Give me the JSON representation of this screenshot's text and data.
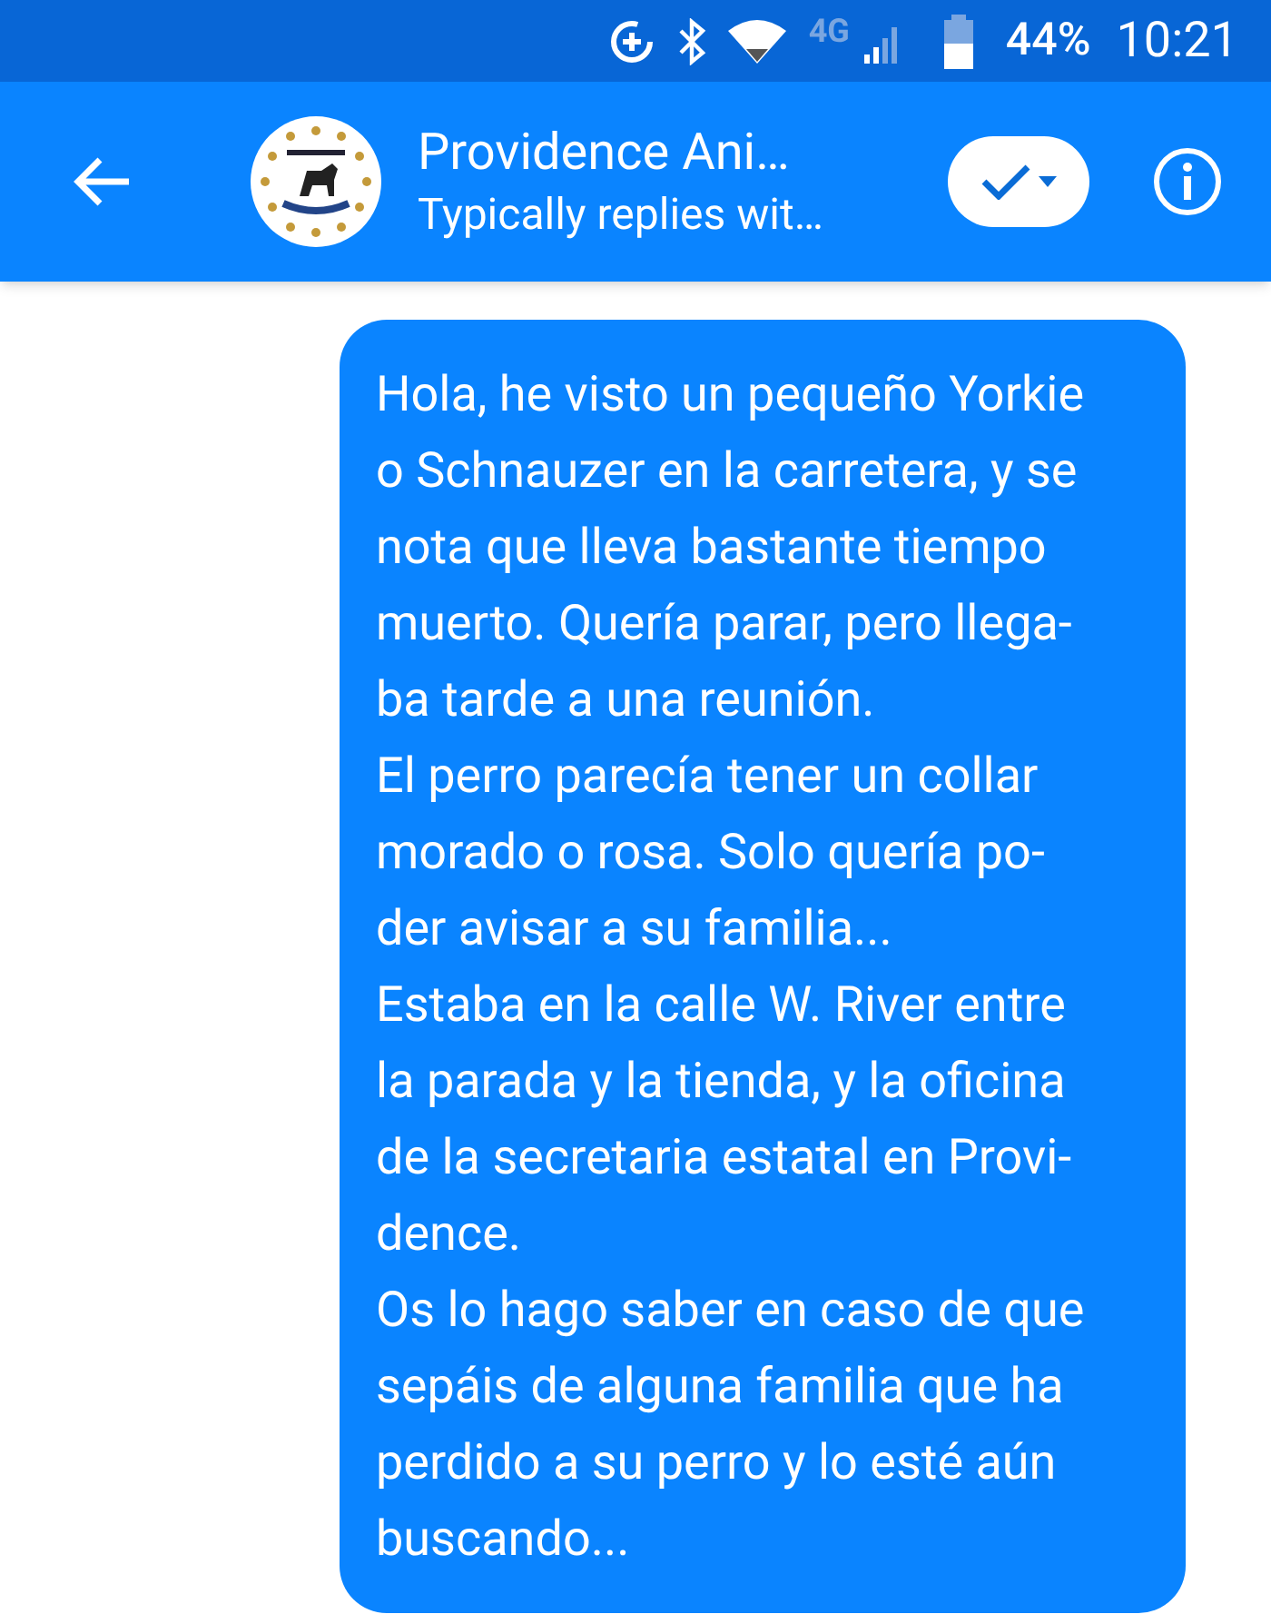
{
  "status_bar": {
    "battery": "44%",
    "time": "10:21",
    "network": "4G"
  },
  "header": {
    "title": "Providence Ani…",
    "subtitle": "Typically replies wit…"
  },
  "messages": [
    {
      "kind": "outgoing",
      "text": "Hola, he visto un pequeño Yorkie\no Schnauzer en la carretera, y se\nnota que lleva bastante tiempo\nmuerto. Quería parar, pero llega-\nba tarde a una reunión.\nEl perro parecía tener un collar\nmorado o rosa. Solo quería po-\nder avisar a su familia...\nEstaba en la calle W. River entre\nla parada y la tienda, y la oficina\nde la secretaria estatal en Provi-\ndence.\nOs lo hago saber en caso de que\nsepáis de alguna familia que ha\nperdido a su perro y lo esté aún\nbuscando..."
    }
  ]
}
